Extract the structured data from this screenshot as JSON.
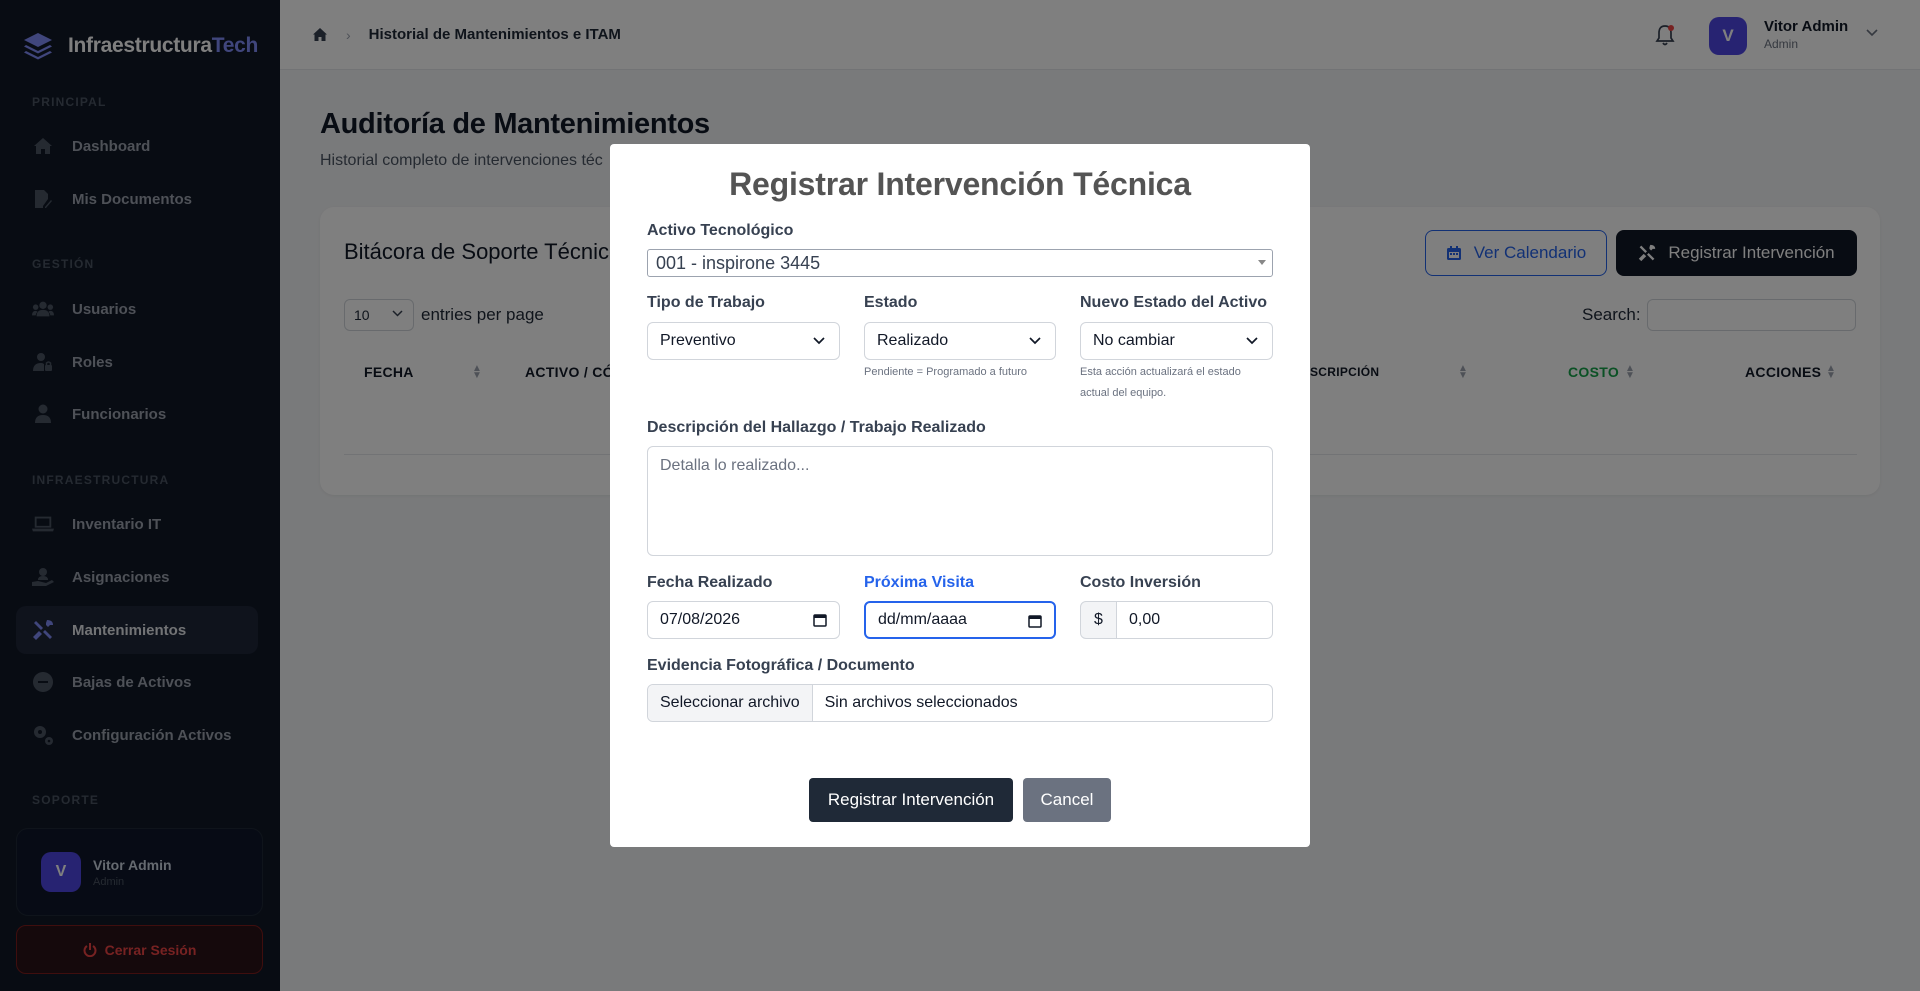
{
  "brand": {
    "name_main": "Infraestructura",
    "name_accent": "Tech"
  },
  "sidebar": {
    "sections": [
      {
        "label": "PRINCIPAL"
      },
      {
        "label": "GESTIÓN"
      },
      {
        "label": "INFRAESTRUCTURA"
      },
      {
        "label": "SOPORTE"
      }
    ],
    "items": [
      {
        "label": "Dashboard",
        "icon": "home-icon"
      },
      {
        "label": "Mis Documentos",
        "icon": "file-edit-icon"
      },
      {
        "label": "Usuarios",
        "icon": "users-icon"
      },
      {
        "label": "Roles",
        "icon": "user-lock-icon"
      },
      {
        "label": "Funcionarios",
        "icon": "user-icon"
      },
      {
        "label": "Inventario IT",
        "icon": "laptop-icon"
      },
      {
        "label": "Asignaciones",
        "icon": "hand-user-icon"
      },
      {
        "label": "Mantenimientos",
        "icon": "tools-icon",
        "active": true
      },
      {
        "label": "Bajas de Activos",
        "icon": "minus-circle-icon"
      },
      {
        "label": "Configuración Activos",
        "icon": "cogs-icon"
      }
    ],
    "user": {
      "initial": "V",
      "name": "Vitor Admin",
      "role": "Admin"
    },
    "logout_label": "Cerrar Sesión"
  },
  "topbar": {
    "breadcrumb": "Historial de Mantenimientos e ITAM",
    "user": {
      "initial": "V",
      "name": "Vitor Admin",
      "role": "Admin"
    }
  },
  "page": {
    "title": "Auditoría de Mantenimientos",
    "subtitle": "Historial completo de intervenciones téc"
  },
  "card": {
    "title": "Bitácora de Soporte Técnico",
    "btn_calendar": "Ver Calendario",
    "btn_register": "Registrar Intervención",
    "entries_value": "10",
    "entries_label": "entries per page",
    "search_label": "Search:",
    "columns": [
      "FECHA",
      "ACTIVO / CÓ",
      "SCRIPCIÓN",
      "COSTO",
      "ACCIONES"
    ]
  },
  "modal": {
    "title": "Registrar Intervención Técnica",
    "asset_label": "Activo Tecnológico",
    "asset_value": "001 - inspirone 3445",
    "work_type_label": "Tipo de Trabajo",
    "work_type_value": "Preventivo",
    "status_label": "Estado",
    "status_value": "Realizado",
    "status_hint": "Pendiente = Programado a futuro",
    "new_status_label": "Nuevo Estado del Activo",
    "new_status_value": "No cambiar",
    "new_status_hint_1": "Esta acción actualizará el estado",
    "new_status_hint_2": "actual del equipo.",
    "desc_label": "Descripción del Hallazgo / Trabajo Realizado",
    "desc_placeholder": "Detalla lo realizado...",
    "date_done_label": "Fecha Realizado",
    "date_done_value": "07/08/2026",
    "next_visit_label": "Próxima Visita",
    "next_visit_value": "dd/mm/aaaa",
    "cost_label": "Costo Inversión",
    "cost_prefix": "$",
    "cost_value": "0,00",
    "evidence_label": "Evidencia Fotográfica / Documento",
    "file_button": "Seleccionar archivo",
    "file_status": "Sin archivos seleccionados",
    "submit_label": "Registrar Intervención",
    "cancel_label": "Cancel"
  },
  "colors": {
    "accent": "#4f46e5",
    "sidebar_bg": "#111827",
    "primary_blue": "#2563eb",
    "cost_green": "#16a34a",
    "danger": "#ef4444"
  }
}
